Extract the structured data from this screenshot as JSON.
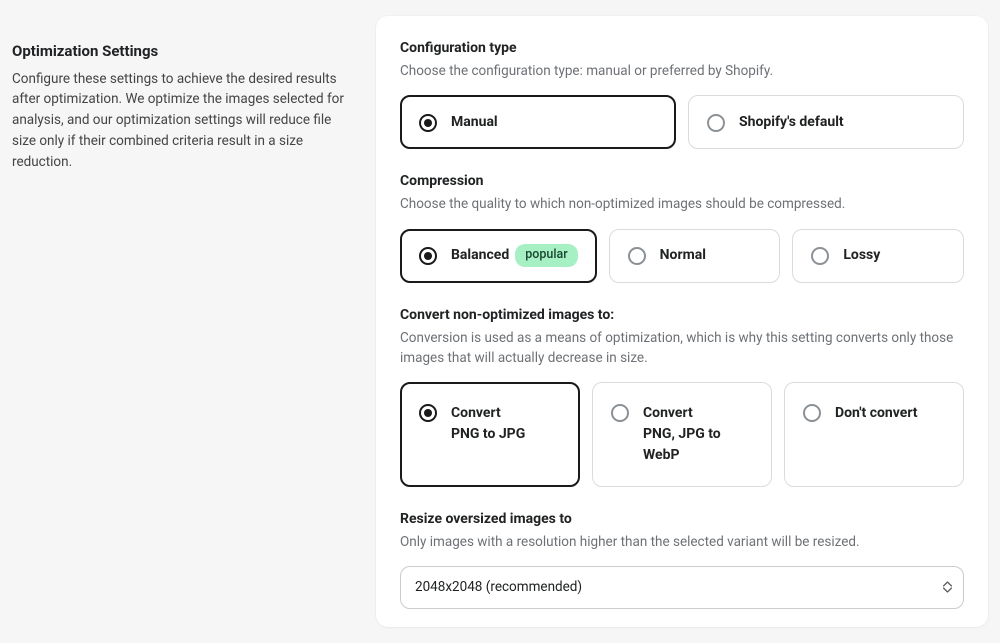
{
  "sidebar": {
    "title": "Optimization Settings",
    "description": "Configure these settings to achieve the desired results after optimization. We optimize the images selected for analysis, and our optimization settings will reduce file size only if their combined criteria result in a size reduction."
  },
  "configType": {
    "title": "Configuration type",
    "description": "Choose the configuration type: manual or preferred by Shopify.",
    "options": {
      "manual": "Manual",
      "shopify": "Shopify's default"
    }
  },
  "compression": {
    "title": "Compression",
    "description": "Choose the quality to which non-optimized images should be compressed.",
    "options": {
      "balanced": "Balanced",
      "balancedBadge": "popular",
      "normal": "Normal",
      "lossy": "Lossy"
    }
  },
  "convert": {
    "title": "Convert non-optimized images to:",
    "description": "Conversion is used as a means of optimization, which is why this setting converts only those images that will actually decrease in size.",
    "options": {
      "pngToJpg": {
        "line1": "Convert",
        "line2": "PNG to JPG"
      },
      "toWebp": {
        "line1": "Convert",
        "line2": "PNG, JPG to WebP"
      },
      "none": "Don't convert"
    }
  },
  "resize": {
    "title": "Resize oversized images to",
    "description": "Only images with a resolution higher than the selected variant will be resized.",
    "selected": "2048x2048 (recommended)"
  }
}
